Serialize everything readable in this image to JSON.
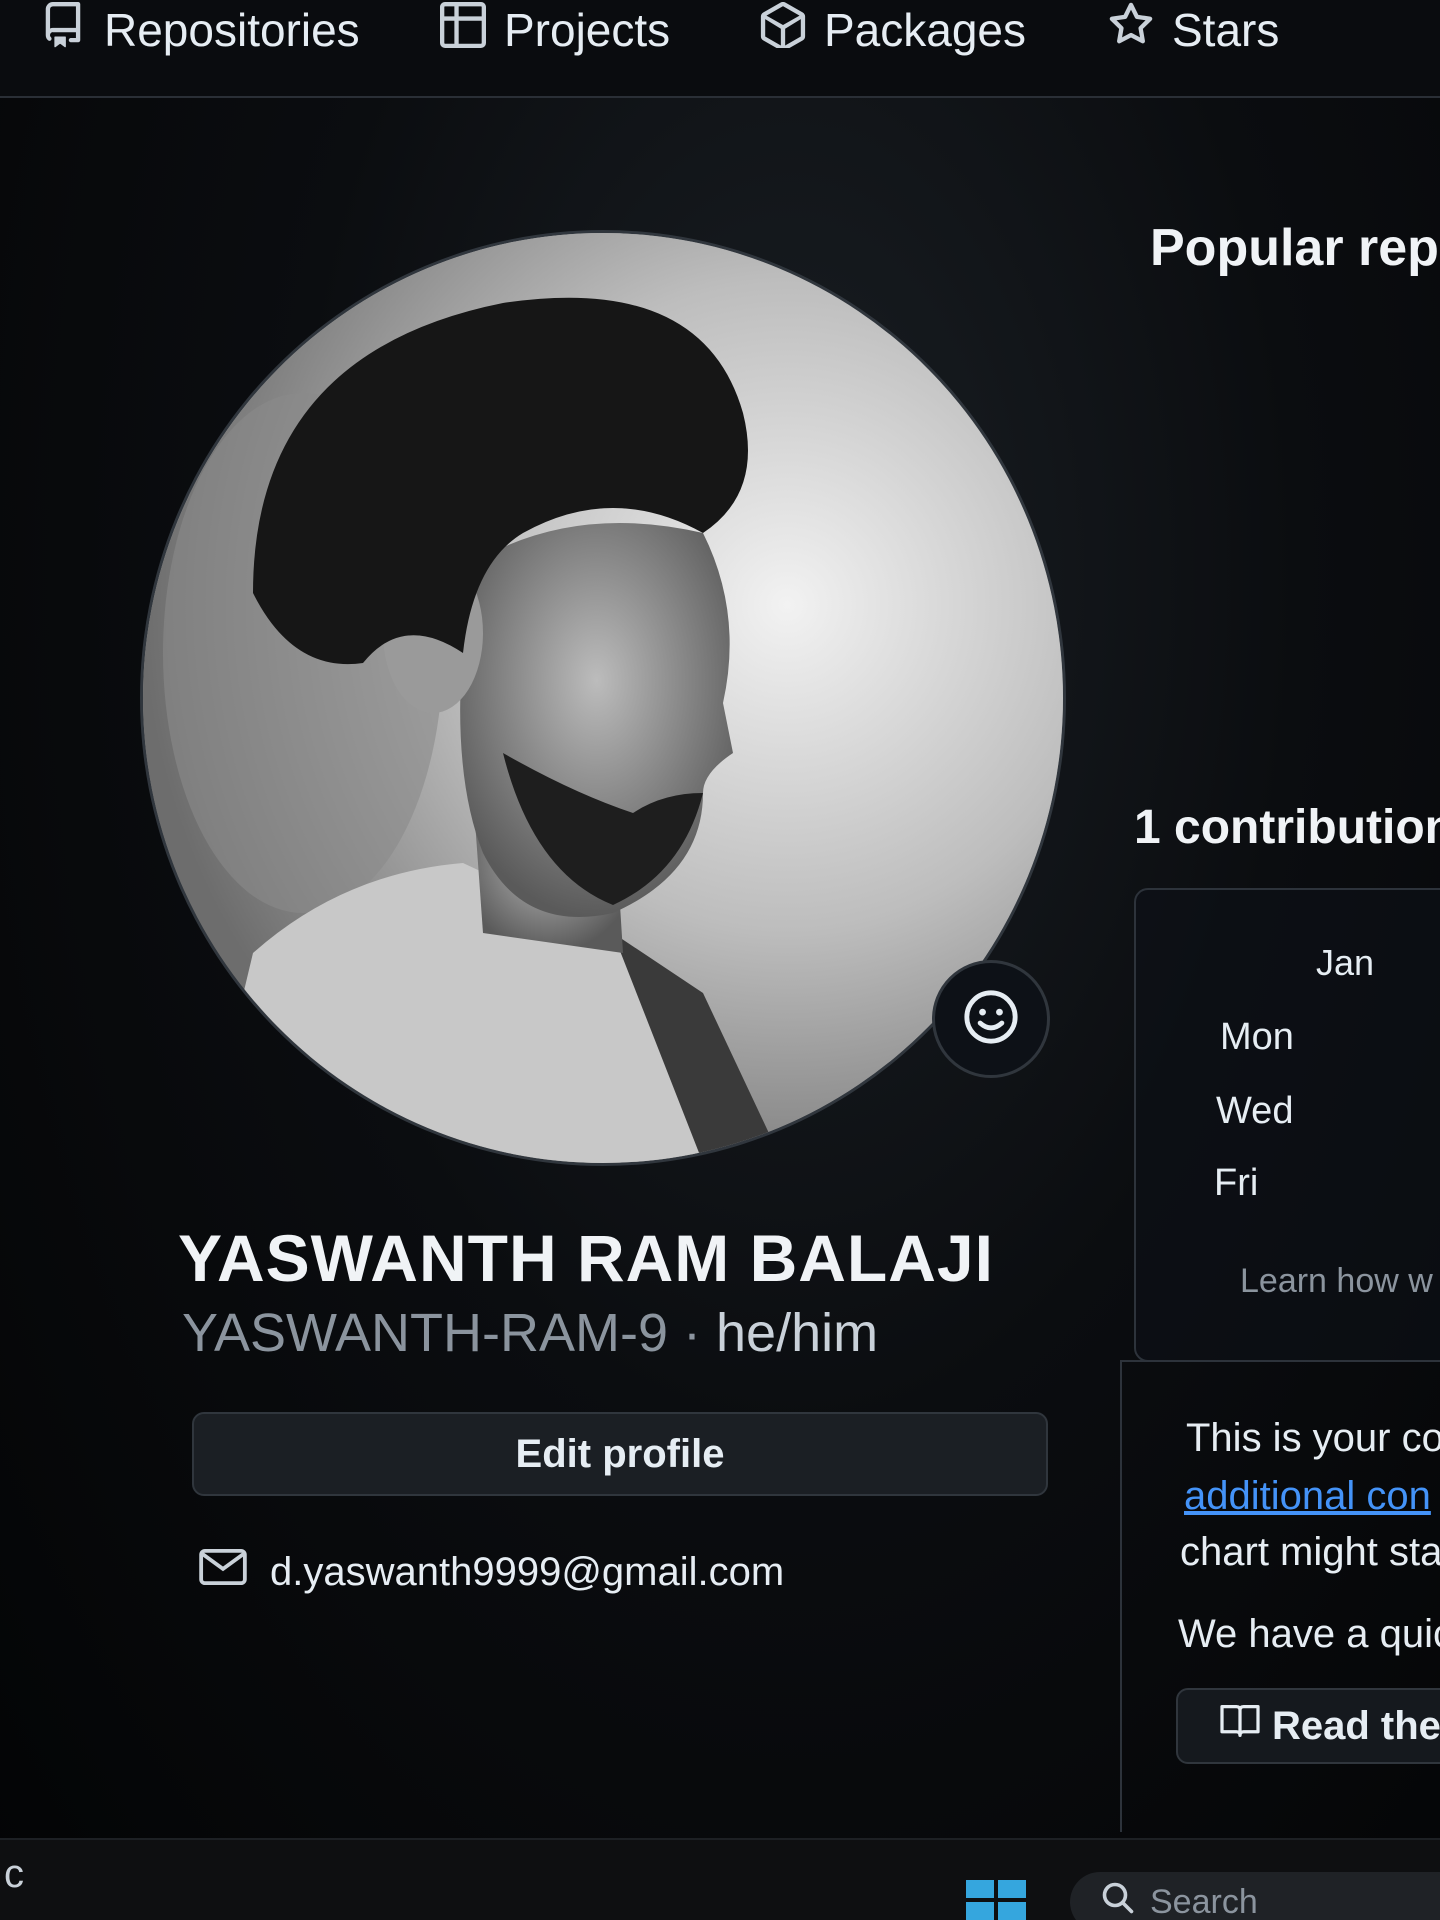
{
  "topnav": {
    "tabs": [
      {
        "label": "Repositories",
        "icon": "repo-icon"
      },
      {
        "label": "Projects",
        "icon": "table-icon"
      },
      {
        "label": "Packages",
        "icon": "package-icon"
      },
      {
        "label": "Stars",
        "icon": "star-icon"
      }
    ]
  },
  "profile": {
    "full_name": "YASWANTH RAM BALAJI",
    "username": "YASWANTH-RAM-9",
    "separator": " · ",
    "pronouns": "he/him",
    "edit_button": "Edit profile",
    "email": "d.yaswanth9999@gmail.com",
    "status_icon": "smiley-icon"
  },
  "right": {
    "popular_title": "Popular repo",
    "contrib_title": "1 contribution",
    "month": "Jan",
    "days": [
      "Mon",
      "Wed",
      "Fri"
    ],
    "learn_text": "Learn how w",
    "activity_lines": [
      "This is your co",
      "additional con",
      "chart might sta",
      "We have a quic"
    ],
    "read_button": "Read the"
  },
  "taskbar": {
    "left_char": "c",
    "search_placeholder": "Search"
  },
  "colors": {
    "accent_link": "#4493f8",
    "windows_logo": "#35a6de"
  }
}
